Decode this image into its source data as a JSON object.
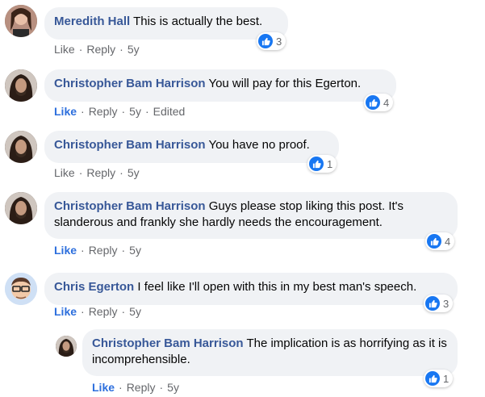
{
  "comments": [
    {
      "author": "Meredith Hall",
      "text": "This is actually the best.",
      "like": "Like",
      "reply": "Reply",
      "time": "5y",
      "reactions": "3",
      "edited": ""
    },
    {
      "author": "Christopher Bam Harrison",
      "text": "You will pay for this Egerton.",
      "like": "Like",
      "reply": "Reply",
      "time": "5y",
      "reactions": "4",
      "edited": "Edited"
    },
    {
      "author": "Christopher Bam Harrison",
      "text": "You have no proof.",
      "like": "Like",
      "reply": "Reply",
      "time": "5y",
      "reactions": "1",
      "edited": ""
    },
    {
      "author": "Christopher Bam Harrison",
      "text": "Guys please stop liking this post. It's slanderous and frankly she hardly needs the encouragement.",
      "like": "Like",
      "reply": "Reply",
      "time": "5y",
      "reactions": "4",
      "edited": ""
    },
    {
      "author": "Chris Egerton",
      "text": "I feel like I'll open with this in my best man's speech.",
      "like": "Like",
      "reply": "Reply",
      "time": "5y",
      "reactions": "3",
      "edited": ""
    },
    {
      "author": "Christopher Bam Harrison",
      "text": "The implication is as horrifying as it is incomprehensible.",
      "like": "Like",
      "reply": "Reply",
      "time": "5y",
      "reactions": "1",
      "edited": ""
    }
  ],
  "colors": {
    "author": "#385898",
    "like_active": "#2d6fdd",
    "bubble": "#f0f2f5",
    "reaction": "#1877f2"
  },
  "icons": {
    "reaction": "like-thumb-icon",
    "avatar": "user-avatar"
  }
}
